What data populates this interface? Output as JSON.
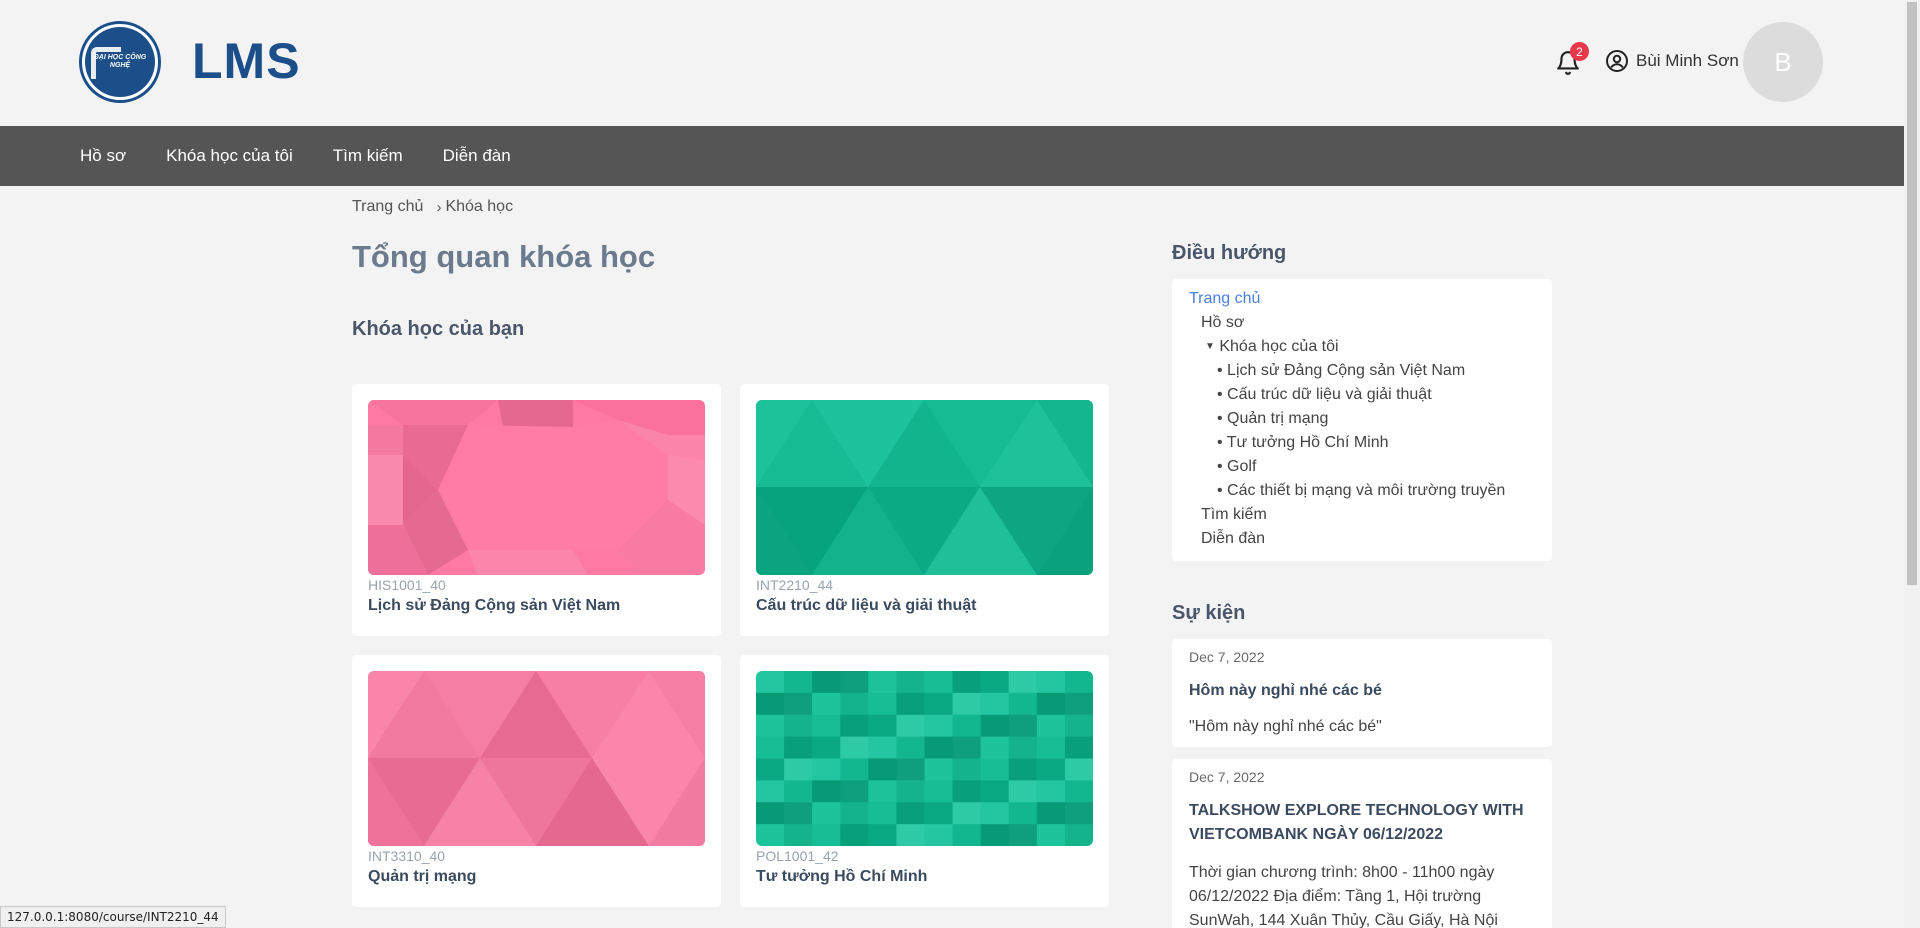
{
  "header": {
    "brand": "LMS",
    "notification_count": "2",
    "user_name": "Bùi Minh Sơn",
    "avatar_initial": "B",
    "logo_text": "ĐẠI HỌC CÔNG NGHỆ"
  },
  "nav": {
    "items": [
      "Hồ sơ",
      "Khóa học của tôi",
      "Tìm kiếm",
      "Diễn đàn"
    ]
  },
  "breadcrumb": {
    "home": "Trang chủ",
    "current": "Khóa học"
  },
  "main": {
    "title": "Tổng quan khóa học",
    "section": "Khóa học của bạn",
    "courses": [
      {
        "code": "HIS1001_40",
        "name": "Lịch sử Đảng Cộng sản Việt Nam",
        "color": "#ff7aa2"
      },
      {
        "code": "INT2210_44",
        "name": "Cấu trúc dữ liệu và giải thuật",
        "color": "#12b78f"
      },
      {
        "code": "INT3310_40",
        "name": "Quản trị mạng",
        "color": "#f57aa0"
      },
      {
        "code": "POL1001_42",
        "name": "Tư tưởng Hồ Chí Minh",
        "color": "#13b88f"
      }
    ]
  },
  "sidebar": {
    "nav_heading": "Điều hướng",
    "nav_items": {
      "home": "Trang chủ",
      "profile": "Hồ sơ",
      "my_courses": "Khóa học của tôi",
      "course_list": [
        "Lịch sử Đảng Cộng sản Việt Nam",
        "Cấu trúc dữ liệu và giải thuật",
        "Quản trị mạng",
        "Tư tưởng Hồ Chí Minh",
        "Golf",
        "Các thiết bị mạng và môi trường truyền"
      ],
      "search": "Tìm kiếm",
      "forum": "Diễn đàn"
    },
    "events_heading": "Sự kiện",
    "events": [
      {
        "date": "Dec 7, 2022",
        "title": "Hôm này nghỉ nhé các bé",
        "desc": "\"Hôm này nghỉ nhé các bé\""
      },
      {
        "date": "Dec 7, 2022",
        "title": "TALKSHOW EXPLORE TECHNOLOGY WITH VIETCOMBANK NGÀY 06/12/2022",
        "desc": "Thời gian chương trình: 8h00 - 11h00 ngày 06/12/2022 Địa điểm: Tầng 1, Hội trường SunWah, 144 Xuân Thủy, Cầu Giấy, Hà Nội"
      }
    ]
  },
  "status_bar": "127.0.0.1:8080/course/INT2210_44"
}
